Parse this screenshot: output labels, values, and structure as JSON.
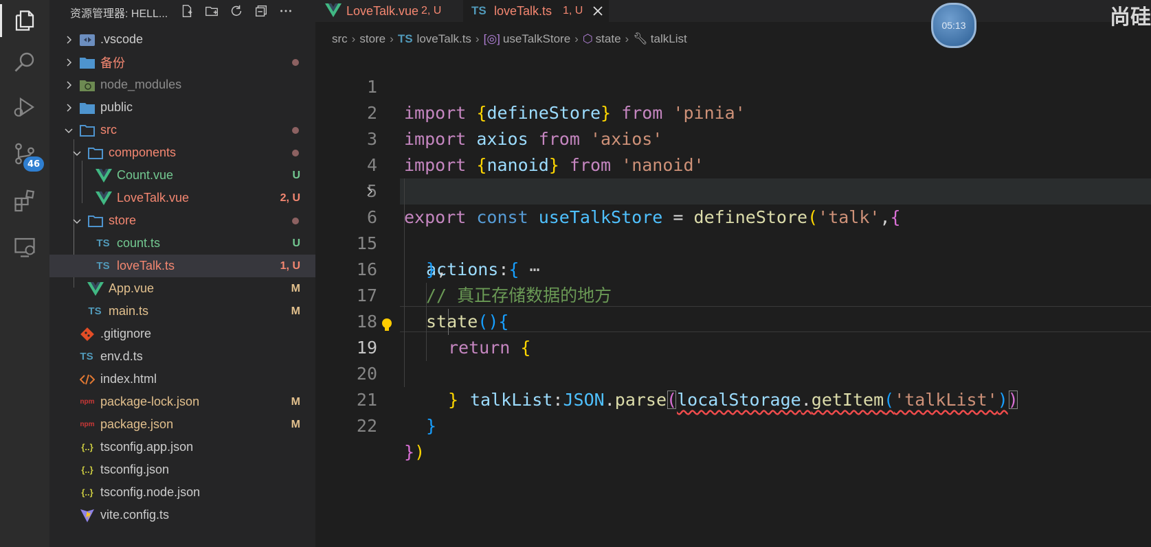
{
  "activity_bar": {
    "source_control_badge": "46"
  },
  "sidebar": {
    "title": "资源管理器: HELL...",
    "tree": [
      {
        "name": ".vscode",
        "status": "",
        "dot": false
      },
      {
        "name": "备份",
        "status": "",
        "dot": true
      },
      {
        "name": "node_modules",
        "status": "",
        "dot": false
      },
      {
        "name": "public",
        "status": "",
        "dot": false
      },
      {
        "name": "src",
        "status": "",
        "dot": true
      },
      {
        "name": "components",
        "status": "",
        "dot": true
      },
      {
        "name": "Count.vue",
        "status": "U",
        "dot": false
      },
      {
        "name": "LoveTalk.vue",
        "status": "2, U",
        "dot": false
      },
      {
        "name": "store",
        "status": "",
        "dot": true
      },
      {
        "name": "count.ts",
        "status": "U",
        "dot": false
      },
      {
        "name": "loveTalk.ts",
        "status": "1, U",
        "dot": false
      },
      {
        "name": "App.vue",
        "status": "M",
        "dot": false
      },
      {
        "name": "main.ts",
        "status": "M",
        "dot": false
      },
      {
        "name": ".gitignore",
        "status": "",
        "dot": false
      },
      {
        "name": "env.d.ts",
        "status": "",
        "dot": false
      },
      {
        "name": "index.html",
        "status": "",
        "dot": false
      },
      {
        "name": "package-lock.json",
        "status": "M",
        "dot": false
      },
      {
        "name": "package.json",
        "status": "M",
        "dot": false
      },
      {
        "name": "tsconfig.app.json",
        "status": "",
        "dot": false
      },
      {
        "name": "tsconfig.json",
        "status": "",
        "dot": false
      },
      {
        "name": "tsconfig.node.json",
        "status": "",
        "dot": false
      },
      {
        "name": "vite.config.ts",
        "status": "",
        "dot": false
      }
    ],
    "icon_labels": {
      "ts": "TS",
      "json": "{..}",
      "npm": "npm"
    }
  },
  "tabs": [
    {
      "label": "LoveTalk.vue",
      "status": "2, U"
    },
    {
      "label": "loveTalk.ts",
      "status": "1, U"
    }
  ],
  "breadcrumb": [
    "src",
    "store",
    "loveTalk.ts",
    "useTalkStore",
    "state",
    "talkList"
  ],
  "editor": {
    "line_numbers": [
      "1",
      "2",
      "3",
      "4",
      "5",
      "6",
      "15",
      "16",
      "17",
      "18",
      "19",
      "20",
      "21",
      "22"
    ],
    "fold_marker": "⋯"
  },
  "overlay": {
    "timer": "05:13",
    "watermark": "尚硅"
  },
  "colors": {
    "accent": "#2f7fd1",
    "modified": "#e2c08d",
    "untracked": "#73c991",
    "error": "#f48771"
  }
}
